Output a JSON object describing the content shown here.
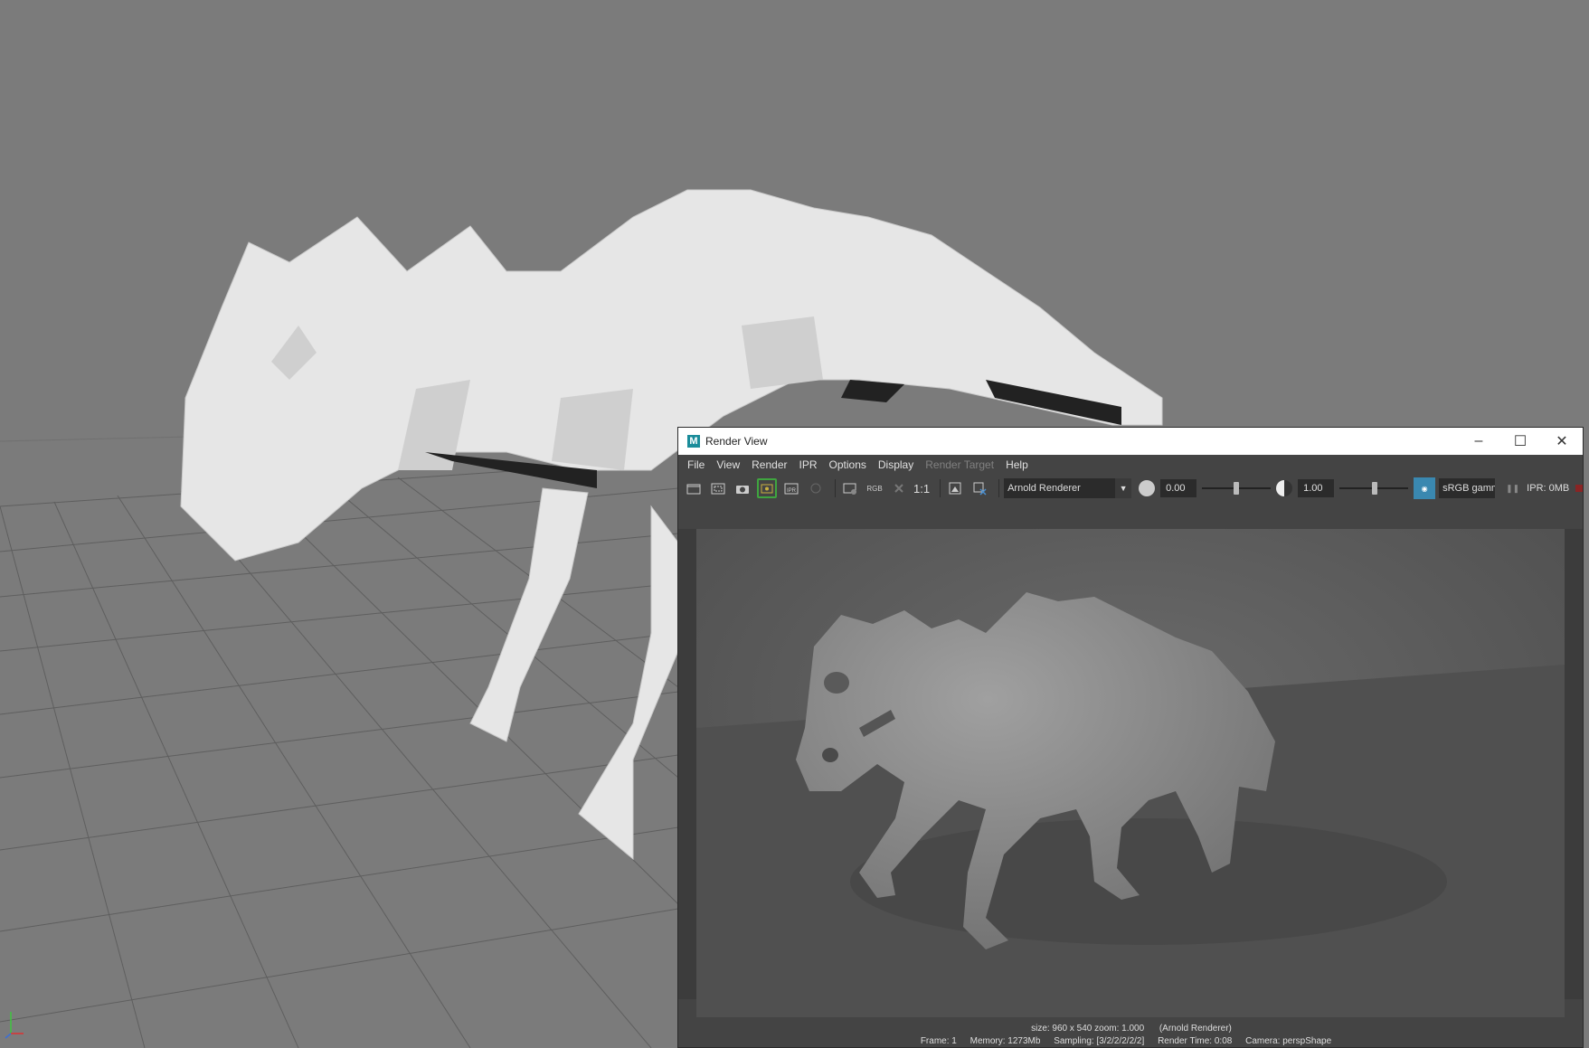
{
  "render_view": {
    "title": "Render View",
    "logo_letter": "M",
    "menu": [
      "File",
      "View",
      "Render",
      "IPR",
      "Options",
      "Display",
      "Render Target",
      "Help"
    ],
    "toolbar": {
      "rgb_label": "RGB",
      "ratio_label": "1:1",
      "renderer": "Arnold Renderer",
      "exposure": "0.00",
      "gamma": "1.00",
      "color_space": "sRGB gamma",
      "ipr_memory": "IPR: 0MB"
    },
    "status": {
      "size_info": "size: 960 x 540  zoom: 1.000",
      "renderer_info": "(Arnold Renderer)",
      "frame": "Frame: 1",
      "memory": "Memory: 1273Mb",
      "sampling": "Sampling: [3/2/2/2/2/2]",
      "render_time": "Render Time: 0:08",
      "camera": "Camera: perspShape"
    }
  },
  "icons": [
    "render-frame-icon",
    "render-region-icon",
    "snapshot-icon",
    "ipr-render-icon",
    "ipr-region-icon",
    "stop-icon",
    "render-settings-icon",
    "rgb-channels-icon",
    "display-alpha-icon",
    "real-size-icon",
    "keep-image-icon",
    "remove-image-icon",
    "exposure-icon",
    "gamma-icon",
    "color-management-icon",
    "pause-icon",
    "axis-gizmo-icon"
  ],
  "colors": {
    "viewport_bg": "#7b7b7b",
    "window_bg": "#444444",
    "accent_active": "#3fa53f",
    "cm_toggle": "#3a88b0"
  }
}
